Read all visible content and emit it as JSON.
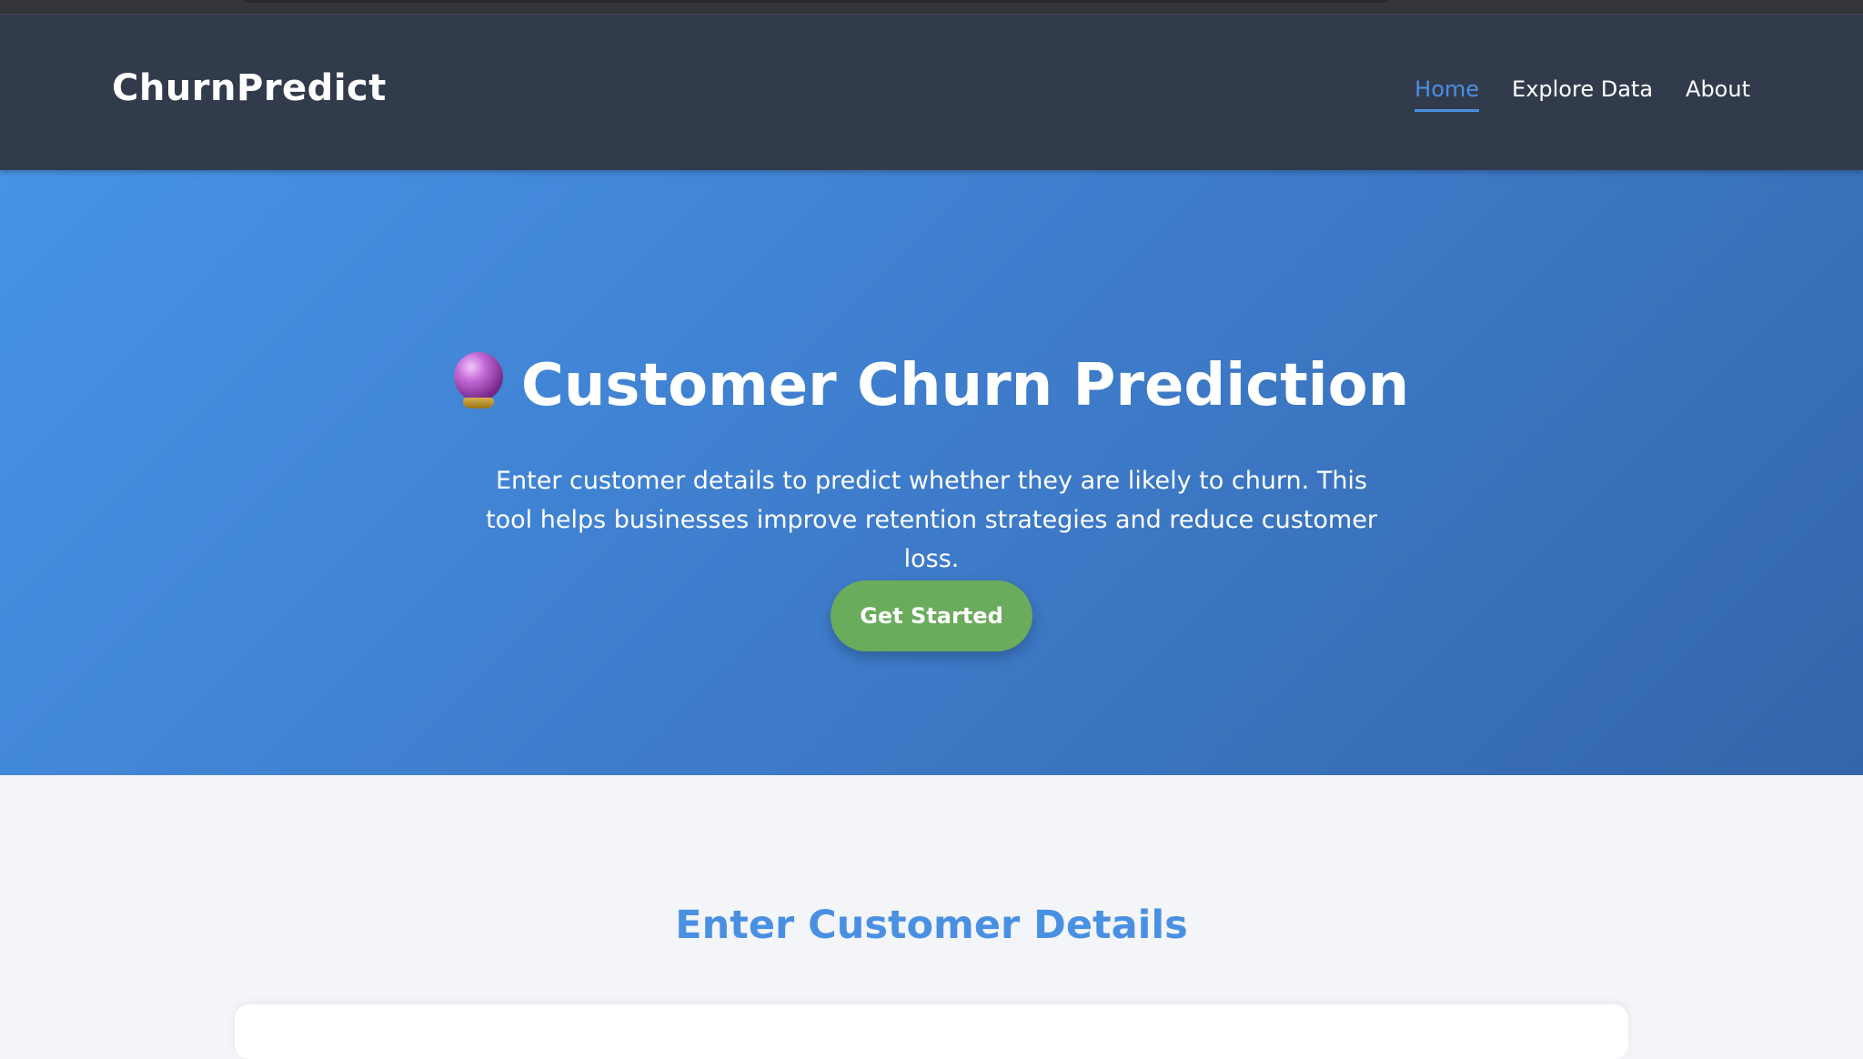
{
  "brand": {
    "name": "ChurnPredict"
  },
  "nav": {
    "items": [
      {
        "label": "Home",
        "active": true
      },
      {
        "label": "Explore Data",
        "active": false
      },
      {
        "label": "About",
        "active": false
      }
    ]
  },
  "hero": {
    "icon": "crystal-ball-icon",
    "title": "Customer Churn Prediction",
    "description": "Enter customer details to predict whether they are likely to churn. This tool helps businesses improve retention strategies and reduce customer loss.",
    "cta_label": "Get Started"
  },
  "form_section": {
    "title": "Enter Customer Details"
  },
  "colors": {
    "navbar": "#323b4c",
    "accent": "#4a90e2",
    "cta": "#6aab5c",
    "page_bg": "#f3f5f9"
  }
}
